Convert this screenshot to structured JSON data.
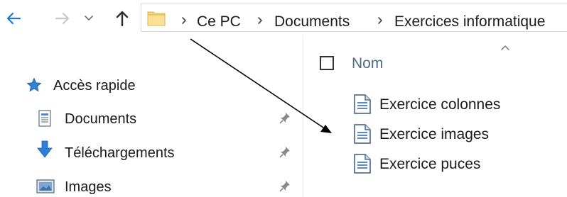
{
  "nav": {
    "back_icon": "arrow-left-icon",
    "forward_icon": "arrow-right-icon",
    "recent_icon": "chevron-down-icon",
    "up_icon": "arrow-up-icon"
  },
  "address": {
    "crumbs": [
      "Ce PC",
      "Documents",
      "Exercices informatique"
    ]
  },
  "sidebar": {
    "quick_access": "Accès rapide",
    "items": [
      {
        "label": "Documents",
        "icon": "document-folder-icon"
      },
      {
        "label": "Téléchargements",
        "icon": "download-arrow-icon"
      },
      {
        "label": "Images",
        "icon": "image-folder-icon"
      }
    ]
  },
  "file_list": {
    "column_name": "Nom",
    "files": [
      {
        "name": "Exercice colonnes"
      },
      {
        "name": "Exercice images"
      },
      {
        "name": "Exercice puces"
      }
    ]
  },
  "colors": {
    "accent_blue": "#1e78d6",
    "header_text": "#4d6b8a",
    "folder_yellow": "#f8d775"
  }
}
